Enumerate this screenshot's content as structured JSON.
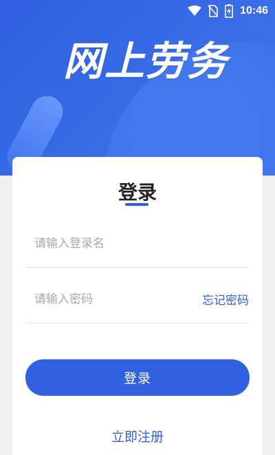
{
  "status_bar": {
    "time": "10:46",
    "icons": [
      "wifi-icon",
      "no-sim-icon",
      "battery-charging-icon"
    ]
  },
  "header": {
    "app_title": "网上劳务"
  },
  "login_card": {
    "title": "登录",
    "username_placeholder": "请输入登录名",
    "password_placeholder": "请输入密码",
    "forgot_password_label": "忘记密码",
    "login_button_label": "登录",
    "register_label": "立即注册"
  },
  "colors": {
    "primary": "#3160e1",
    "header_bg": "#2f5fe0",
    "page_bg": "#efefef"
  }
}
